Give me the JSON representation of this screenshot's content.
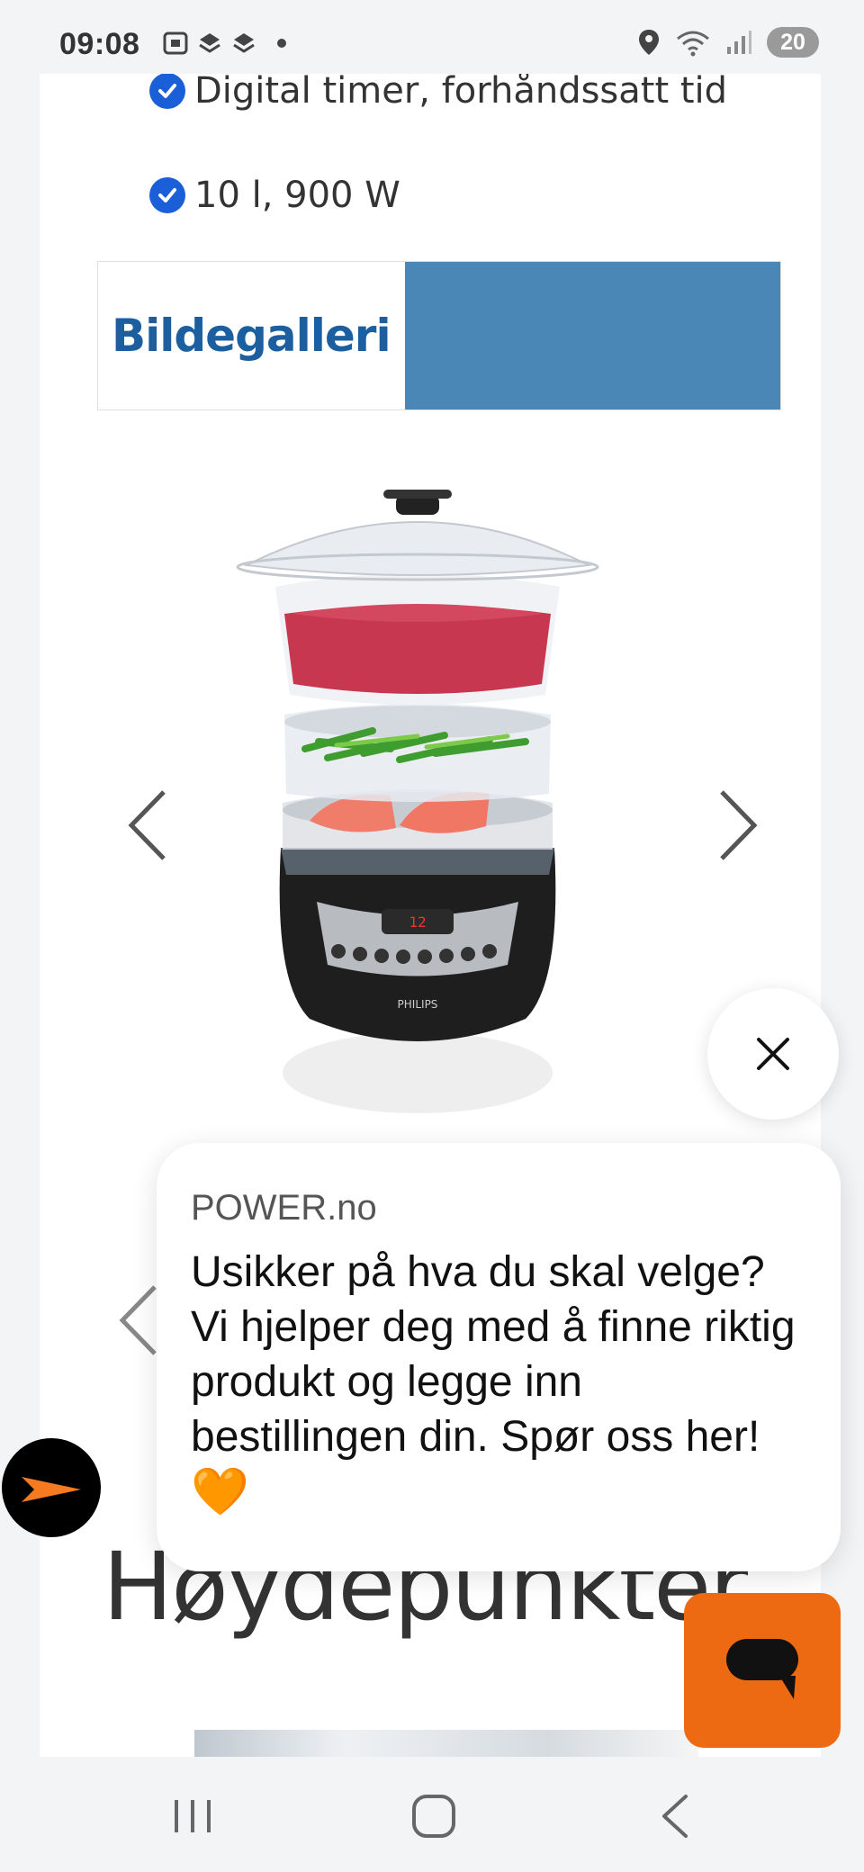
{
  "status_bar": {
    "time": "09:08",
    "battery": "20",
    "icons": [
      "screenshot-icon",
      "stack-icon",
      "stack-icon",
      "location-icon",
      "wifi-icon",
      "signal-icon"
    ]
  },
  "features": [
    {
      "icon": "check-circle-icon",
      "text": "Digital timer, forhåndssatt tid"
    },
    {
      "icon": "check-circle-icon",
      "text": "10 l, 900 W"
    }
  ],
  "gallery": {
    "title": "Bildegalleri",
    "accent_color": "#4a86b6",
    "title_color": "#1b5fa0",
    "image": "Philips food steamer"
  },
  "highlights": {
    "title": "Høydepunkter"
  },
  "chat": {
    "sender": "POWER.no",
    "message": "Usikker på hva du skal velge? Vi hjelper deg med å finne riktig produkt og legge inn bestillingen din. Spør oss her!",
    "emoji": "🧡",
    "button_color": "#ee6a12"
  },
  "nav": {
    "buttons": [
      "recent-apps",
      "home",
      "back"
    ]
  }
}
